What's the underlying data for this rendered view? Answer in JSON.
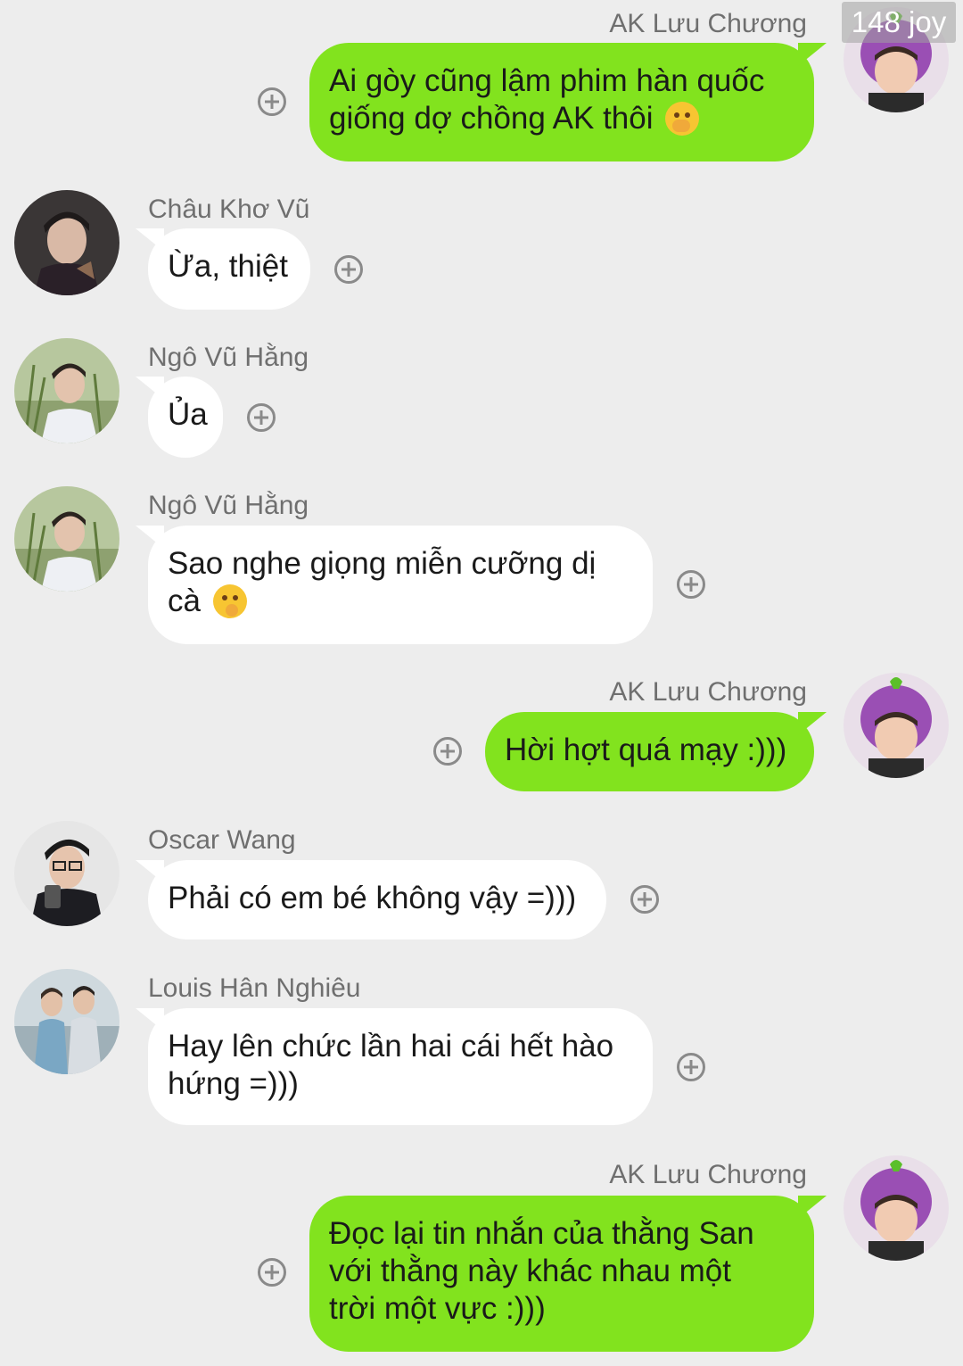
{
  "watermark": "148 joy",
  "messages": [
    {
      "sender": "AK Lưu Chương",
      "side": "out",
      "avatar": "eggplant-hat-avatar",
      "lines": [
        "Ai gòy cũng lậm phim hàn quốc",
        "giống dợ chồng AK thôi"
      ],
      "emoji": "hand-over-mouth-emoji"
    },
    {
      "sender": "Châu Khơ Vũ",
      "side": "in",
      "avatar": "dark-hair-avatar",
      "lines": [
        "Ừa, thiệt"
      ]
    },
    {
      "sender": "Ngô Vũ Hằng",
      "side": "in",
      "avatar": "grass-field-avatar",
      "lines": [
        "Ủa"
      ]
    },
    {
      "sender": "Ngô Vũ Hằng",
      "side": "in",
      "avatar": "grass-field-avatar",
      "lines": [
        "Sao nghe giọng miễn cưỡng dị",
        "cà"
      ],
      "emoji": "thinking-face-emoji"
    },
    {
      "sender": "AK Lưu Chương",
      "side": "out",
      "avatar": "eggplant-hat-avatar",
      "lines": [
        "Hời hợt quá mạy :)))"
      ]
    },
    {
      "sender": "Oscar Wang",
      "side": "in",
      "avatar": "glasses-microphone-avatar",
      "lines": [
        "Phải có em bé không vậy =)))"
      ]
    },
    {
      "sender": "Louis Hân Nghiêu",
      "side": "in",
      "avatar": "two-people-outdoor-avatar",
      "lines": [
        "Hay lên chức lần hai cái hết hào",
        "hứng =)))"
      ]
    },
    {
      "sender": "AK Lưu Chương",
      "side": "out",
      "avatar": "eggplant-hat-avatar",
      "lines": [
        "Đọc lại tin nhắn của thằng San",
        "với thằng này khác nhau một",
        "trời một vực :)))"
      ]
    }
  ]
}
